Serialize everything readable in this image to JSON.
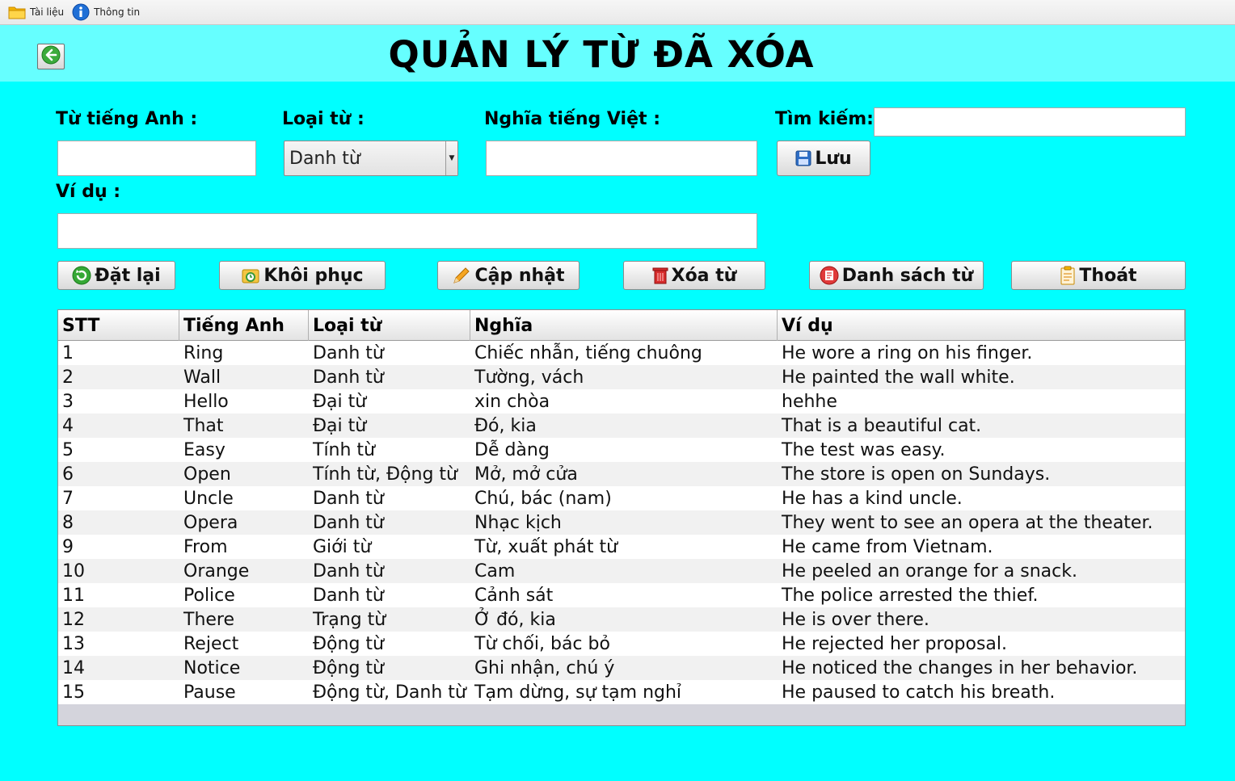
{
  "menu": {
    "items": [
      {
        "label": "Tài liệu",
        "icon": "folder-icon"
      },
      {
        "label": "Thông tin",
        "icon": "info-icon"
      }
    ]
  },
  "header": {
    "title": "QUẢN LÝ TỪ ĐÃ XÓA",
    "back_icon": "back-arrow-icon"
  },
  "form": {
    "english_label": "Từ tiếng Anh :",
    "english_value": "",
    "type_label": "Loại từ :",
    "type_value": "Danh từ",
    "meaning_label": "Nghĩa tiếng Việt :",
    "meaning_value": "",
    "search_label": "Tìm kiếm:",
    "search_value": "",
    "example_label": "Ví dụ :",
    "example_value": "",
    "save_label": "Lưu"
  },
  "actions": {
    "reset_label": "Đặt lại",
    "restore_label": "Khôi phục",
    "update_label": "Cập nhật",
    "delete_label": "Xóa từ",
    "list_label": "Danh sách từ",
    "exit_label": "Thoát"
  },
  "table": {
    "columns": [
      "STT",
      "Tiếng Anh",
      "Loại từ",
      "Nghĩa",
      "Ví dụ"
    ],
    "rows": [
      [
        "1",
        "Ring",
        "Danh từ",
        "Chiếc nhẫn, tiếng chuông",
        "He wore a ring on his finger."
      ],
      [
        "2",
        "Wall",
        "Danh từ",
        "Tường, vách",
        "He painted the wall white."
      ],
      [
        "3",
        "Hello",
        "Đại từ",
        "xin chòa",
        "hehhe"
      ],
      [
        "4",
        "That",
        "Đại từ",
        "Đó, kia",
        "That is a beautiful cat."
      ],
      [
        "5",
        "Easy",
        "Tính từ",
        "Dễ dàng",
        "The test was easy."
      ],
      [
        "6",
        "Open",
        "Tính từ, Động từ",
        "Mở, mở cửa",
        "The store is open on Sundays."
      ],
      [
        "7",
        "Uncle",
        "Danh từ",
        "Chú, bác (nam)",
        "He has a kind uncle."
      ],
      [
        "8",
        "Opera",
        "Danh từ",
        "Nhạc kịch",
        "They went to see an opera at the theater."
      ],
      [
        "9",
        "From",
        "Giới từ",
        "Từ, xuất phát từ",
        "He came from Vietnam."
      ],
      [
        "10",
        "Orange",
        "Danh từ",
        "Cam",
        "He peeled an orange for a snack."
      ],
      [
        "11",
        "Police",
        "Danh từ",
        "Cảnh sát",
        "The police arrested the thief."
      ],
      [
        "12",
        "There",
        "Trạng từ",
        "Ở đó, kia",
        "He is over there."
      ],
      [
        "13",
        "Reject",
        "Động từ",
        "Từ chối, bác bỏ",
        "He rejected her proposal."
      ],
      [
        "14",
        "Notice",
        "Động từ",
        "Ghi nhận, chú ý",
        "He noticed the changes in her behavior."
      ],
      [
        "15",
        "Pause",
        "Động từ, Danh từ",
        "Tạm dừng, sự tạm nghỉ",
        "He paused to catch his breath."
      ]
    ]
  },
  "colors": {
    "background": "#00ffff",
    "header_panel": "#66ffff"
  }
}
